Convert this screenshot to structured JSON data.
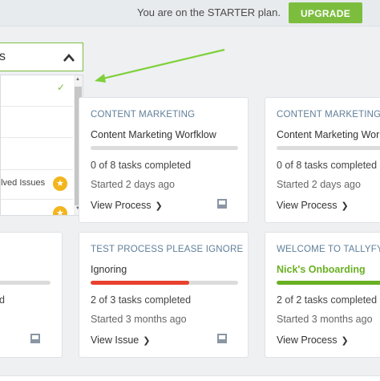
{
  "topbar": {
    "plan_text": "You are on the STARTER plan.",
    "upgrade_label": "UPGRADE"
  },
  "filter": {
    "selected_value": "s",
    "options": [
      {
        "label": "",
        "checked": true
      },
      {
        "label": "",
        "checked": false
      },
      {
        "label": "",
        "checked": false
      },
      {
        "label": "olved Issues",
        "starred": true
      },
      {
        "label": "",
        "starred": true
      }
    ]
  },
  "cards": [
    {
      "category": "CONTENT MARKETING",
      "title": "Content Marketing Worfklow",
      "progress": 0,
      "tasks": "0 of 8 tasks completed",
      "started": "Started 2 days ago",
      "action": "View Process"
    },
    {
      "category": "CONTENT MARKETING",
      "title": "Content Marketing Wor",
      "progress": 0,
      "tasks": "0 of 8 tasks completed",
      "started": "Started 2 days ago",
      "action": "View Process"
    },
    {
      "category": "",
      "title": "",
      "progress": 0,
      "tasks": "d",
      "started": "",
      "action": ""
    },
    {
      "category": "TEST PROCESS PLEASE IGNORE",
      "title": "Ignoring",
      "progress": 0.67,
      "progress_color": "#e8412e",
      "tasks": "2 of 3 tasks completed",
      "started": "Started 3 months ago",
      "action": "View Issue"
    },
    {
      "category": "WELCOME TO TALLYFY",
      "title": "Nick's Onboarding",
      "title_green": true,
      "progress": 1,
      "progress_color": "#6ab023",
      "tasks": "2 of 2 tasks completed",
      "started": "Started 3 months ago",
      "action": "View Process"
    }
  ],
  "colors": {
    "accent": "#7cbd3e",
    "danger": "#e8412e",
    "link": "#5f7f9a"
  }
}
